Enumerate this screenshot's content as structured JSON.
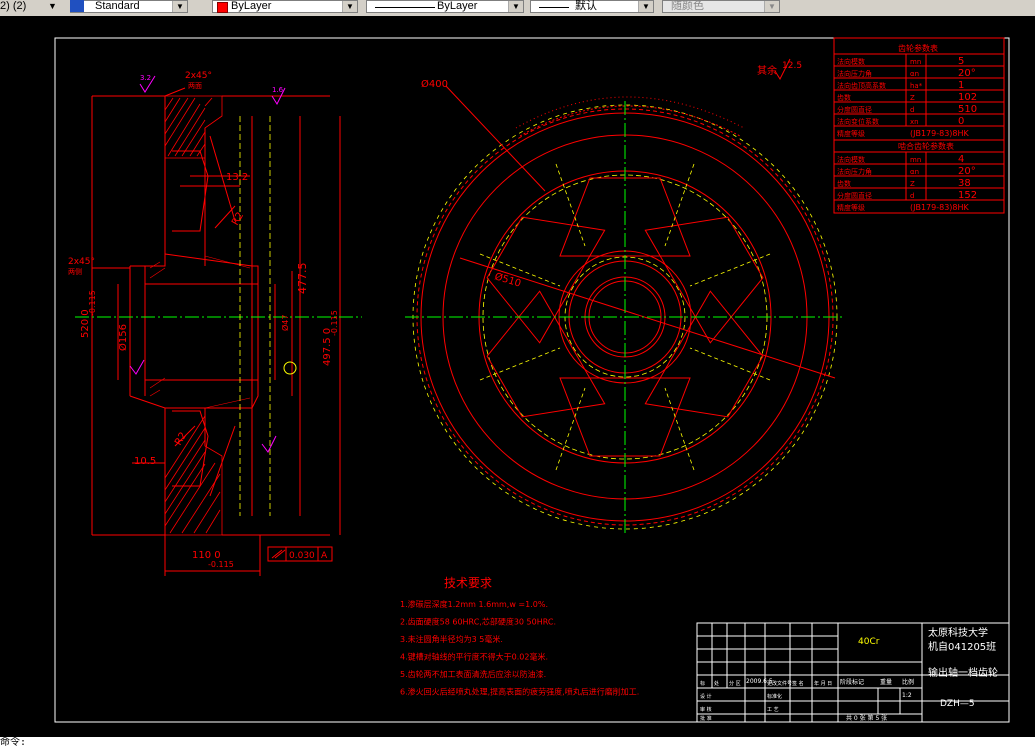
{
  "toolbar": {
    "layer_prefix": "2) (2)",
    "text_style": "Standard",
    "color_control": "ByLayer",
    "linetype_control": "ByLayer",
    "lineweight_control": "默认",
    "plotstyle_control": "随颜色"
  },
  "colors": {
    "red": "#ff0000",
    "green": "#00ff00",
    "yellow": "#ffff00",
    "white": "#ffffff",
    "cyan": "#00ffff",
    "magenta": "#ff00ff"
  },
  "drawing": {
    "dims": {
      "chamfer_top": "2x45°",
      "chamfer_top_note": "两面",
      "chamfer_left": "2x45°",
      "chamfer_left_note": "两侧",
      "r13_2": "13.2",
      "r2": "R2",
      "r2_b": "R2",
      "d477_5": "477.5",
      "d520": "520 0",
      "d520_tol": "-0.115",
      "d497_5": "497.5 0",
      "d497_5_tol": "-0.115",
      "phi156": "Ø156",
      "phi47": "Ø47",
      "d10_5": "10.5",
      "d110": "110 0",
      "d110_tol": "-0.115",
      "phi400": "Ø400",
      "phi510": "Ø510",
      "tolerance_value": "0.030",
      "tolerance_datum": "A",
      "rough_rest": "其余",
      "rough_value": "12.5",
      "rough_top1": "3.2",
      "rough_top2": "1.6"
    },
    "tech_req": {
      "title": "技术要求",
      "items": [
        "1.渗碳层深度1.2mm   1.6mm,w  =1.0%.",
        "2.齿面硬度58   60HRC,芯部硬度30   50HRC.",
        "3.未注圆角半径均为3   5毫米.",
        "4.键槽对轴线的平行度不得大于0.02毫米.",
        "5.齿轮两不加工表面清洗后应涂以防油漆.",
        "6.渗火回火后经喷丸处理,提高表面的疲劳强度,喷丸后进行磨削加工."
      ]
    },
    "params_table": {
      "header1": "齿轮参数表",
      "rows1": [
        [
          "法向模数",
          "mn",
          "5"
        ],
        [
          "法向压力角",
          "αn",
          "20°"
        ],
        [
          "法向齿顶高系数",
          "ha*",
          "1"
        ],
        [
          "齿数",
          "Z",
          "102"
        ],
        [
          "分度圆直径",
          "d",
          "510"
        ],
        [
          "法向变位系数",
          "xn",
          "0"
        ],
        [
          "精度等级",
          "",
          "(JB179-83)8HK"
        ]
      ],
      "header2": "啮合齿轮参数表",
      "rows2": [
        [
          "法向模数",
          "mn",
          "4"
        ],
        [
          "法向压力角",
          "αn",
          "20°"
        ],
        [
          "齿数",
          "Z",
          "38"
        ],
        [
          "分度圆直径",
          "d",
          "152"
        ],
        [
          "精度等级",
          "",
          "(JB179-83)8HK"
        ]
      ]
    },
    "title_block": {
      "material": "40Cr",
      "school_line1": "太原科技大学",
      "school_line2": "机自041205班",
      "part_name": "输出轴一档齿轮",
      "drawing_no": "DZH—5",
      "scale": "1:2",
      "mark_col": "阶段标记",
      "weight_col": "重量",
      "scale_col": "比例",
      "date": "2009.6.5",
      "sheets": "共 0 张 第 5 张",
      "small_labels": [
        "标",
        "处",
        "分 区",
        "更改文件号",
        "签 名",
        "年 月 日",
        "设 计",
        "标准化",
        "审 核",
        "工 艺",
        "批 准"
      ]
    }
  },
  "command_line": "命令:"
}
